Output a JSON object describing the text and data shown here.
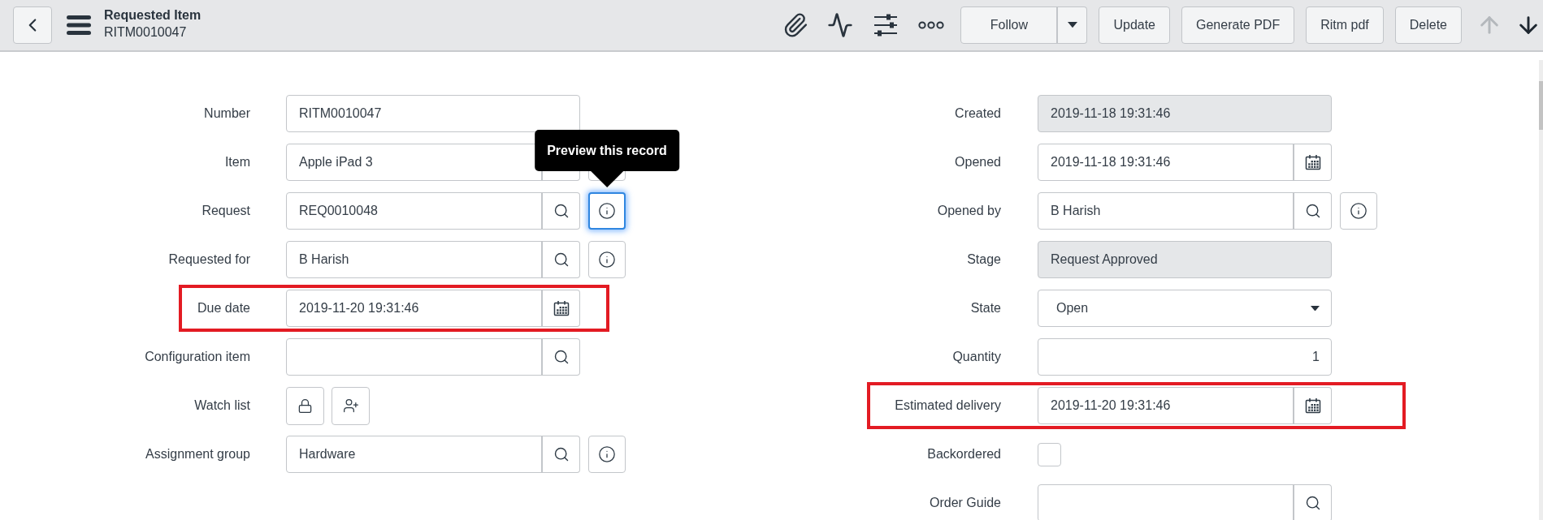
{
  "header": {
    "title": "Requested Item",
    "subtitle": "RITM0010047"
  },
  "toolbar": {
    "follow_button": "Follow",
    "buttons": [
      "Update",
      "Generate PDF",
      "Ritm pdf",
      "Delete"
    ],
    "nav": [
      {
        "kind": "previous",
        "disabled": true
      },
      {
        "kind": "next",
        "disabled": false
      }
    ]
  },
  "form": {
    "left": [
      {
        "label": "Number",
        "kind": "text",
        "value": "RITM0010047",
        "readonly": false,
        "highlighted": false
      },
      {
        "label": "Item",
        "kind": "lookup",
        "value": "Apple iPad 3",
        "readonly": false,
        "highlighted": false,
        "info_button": {
          "focused": false
        }
      },
      {
        "label": "Request",
        "kind": "lookup",
        "value": "REQ0010048",
        "readonly": false,
        "highlighted": false,
        "info_button": {
          "focused": true,
          "tooltip": "Preview this record"
        }
      },
      {
        "label": "Requested for",
        "kind": "lookup",
        "value": "B Harish",
        "readonly": false,
        "highlighted": false,
        "info_button": {
          "focused": false
        }
      },
      {
        "label": "Due date",
        "kind": "date",
        "value": "2019-11-20 19:31:46",
        "readonly": false,
        "highlighted": true
      },
      {
        "label": "Configuration item",
        "kind": "lookup",
        "readonly": false,
        "highlighted": false
      },
      {
        "label": "Watch list",
        "kind": "watchlist",
        "highlighted": false
      },
      {
        "label": "Assignment group",
        "kind": "lookup",
        "value": "Hardware",
        "readonly": false,
        "highlighted": false,
        "info_button": {
          "focused": false
        }
      }
    ],
    "right": [
      {
        "label": "Created",
        "kind": "text",
        "value": "2019-11-18 19:31:46",
        "readonly": true,
        "highlighted": false
      },
      {
        "label": "Opened",
        "kind": "date",
        "value": "2019-11-18 19:31:46",
        "readonly": false,
        "highlighted": false
      },
      {
        "label": "Opened by",
        "kind": "lookup",
        "value": "B Harish",
        "readonly": false,
        "highlighted": false,
        "info_button": {
          "focused": false
        }
      },
      {
        "label": "Stage",
        "kind": "text",
        "value": "Request Approved",
        "readonly": true,
        "highlighted": false
      },
      {
        "label": "State",
        "kind": "select",
        "value": "Open",
        "readonly": false,
        "highlighted": false
      },
      {
        "label": "Quantity",
        "kind": "number",
        "value": "1",
        "readonly": false,
        "highlighted": false
      },
      {
        "label": "Estimated delivery",
        "kind": "date",
        "value": "2019-11-20 19:31:46",
        "readonly": false,
        "highlighted": true
      },
      {
        "label": "Backordered",
        "kind": "checkbox",
        "checked": false,
        "highlighted": false
      },
      {
        "label": "Order Guide",
        "kind": "lookup",
        "readonly": false,
        "highlighted": false
      }
    ]
  }
}
